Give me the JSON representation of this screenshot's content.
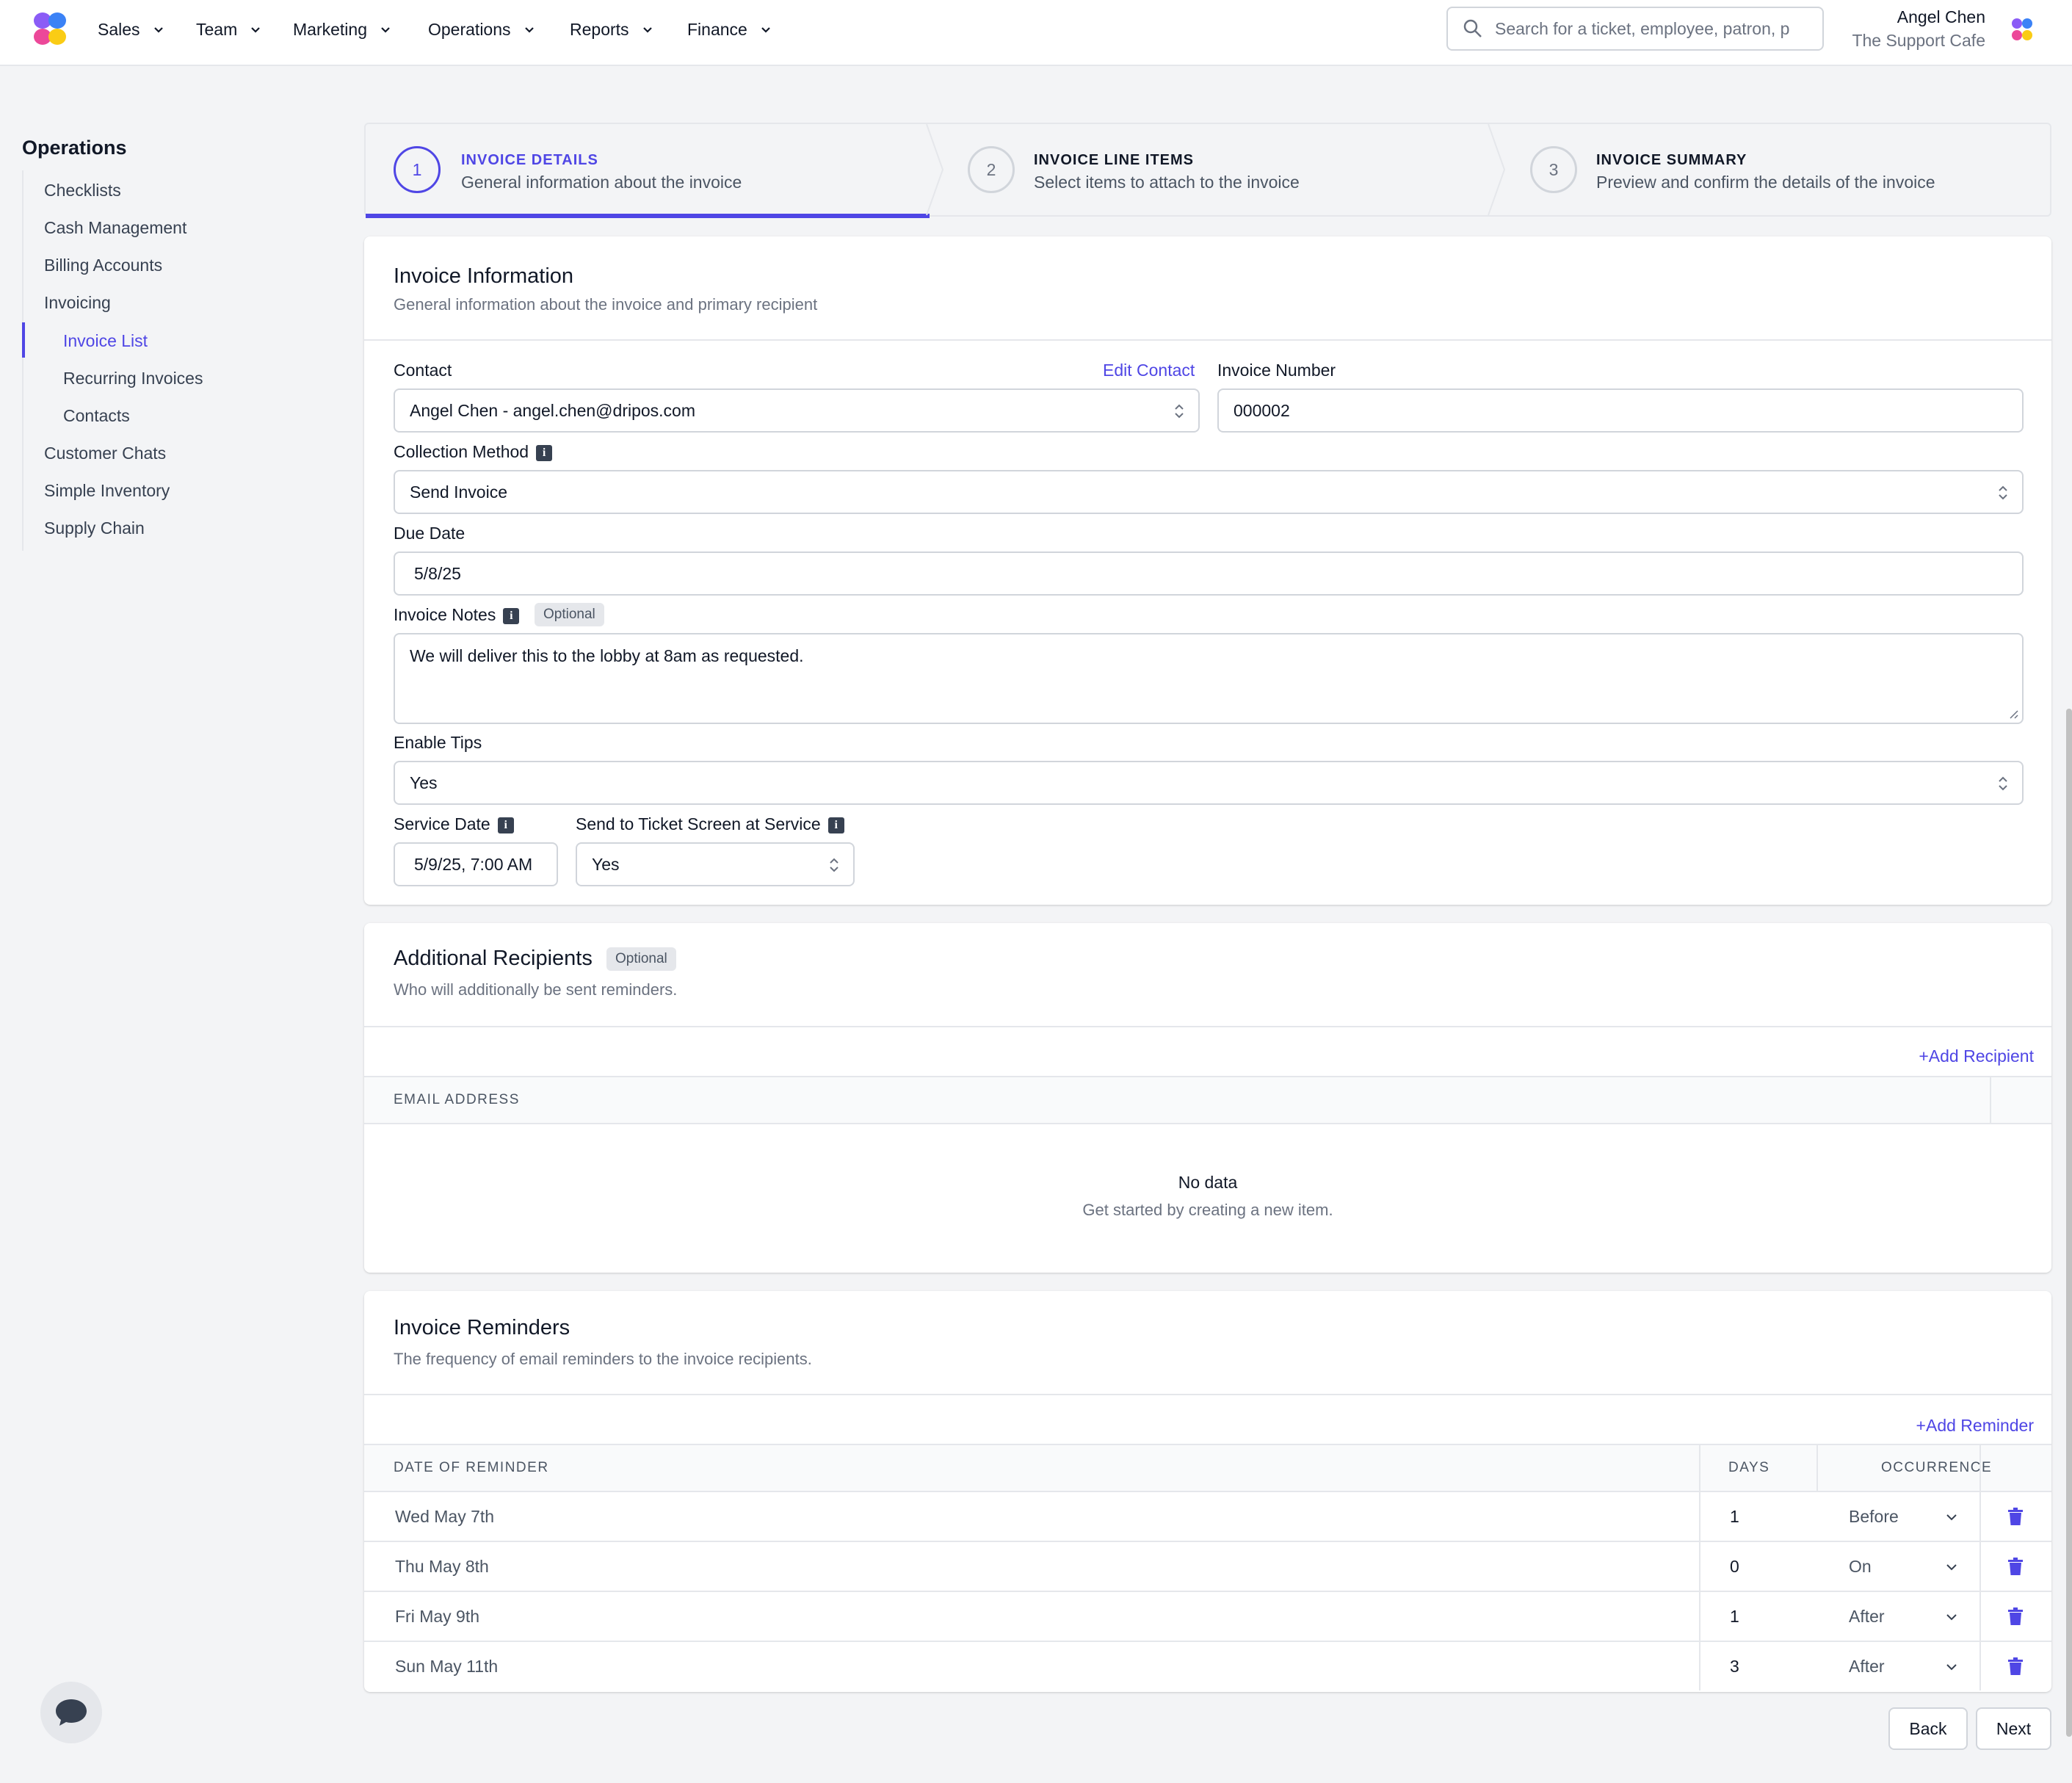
{
  "nav": {
    "items": [
      "Sales",
      "Team",
      "Marketing",
      "Operations",
      "Reports",
      "Finance"
    ],
    "search_placeholder": "Search for a ticket, employee, patron, p",
    "user_name": "Angel Chen",
    "user_org": "The Support Cafe"
  },
  "sidebar": {
    "title": "Operations",
    "items": [
      "Checklists",
      "Cash Management",
      "Billing Accounts",
      "Invoicing",
      "Invoice List",
      "Recurring Invoices",
      "Contacts",
      "Customer Chats",
      "Simple Inventory",
      "Supply Chain"
    ],
    "active": "Invoice List"
  },
  "stepper": {
    "steps": [
      {
        "number": "1",
        "title": "INVOICE DETAILS",
        "desc": "General information about the invoice"
      },
      {
        "number": "2",
        "title": "INVOICE LINE ITEMS",
        "desc": "Select items to attach to the invoice"
      },
      {
        "number": "3",
        "title": "INVOICE SUMMARY",
        "desc": "Preview and confirm the details of the invoice"
      }
    ]
  },
  "invoice_info": {
    "title": "Invoice Information",
    "subtitle": "General information about the invoice and primary recipient",
    "contact_label": "Contact",
    "edit_contact": "Edit Contact",
    "contact_value": "Angel Chen - angel.chen@dripos.com",
    "invoice_number_label": "Invoice Number",
    "invoice_number_value": "000002",
    "collection_method_label": "Collection Method",
    "collection_method_value": "Send Invoice",
    "due_date_label": "Due Date",
    "due_date_value": "5/8/25",
    "notes_label": "Invoice Notes",
    "optional": "Optional",
    "notes_value": "We will deliver this to the lobby at 8am as requested.",
    "tips_label": "Enable Tips",
    "tips_value": "Yes",
    "service_date_label": "Service Date",
    "service_date_value": "5/9/25, 7:00 AM",
    "ticket_screen_label": "Send to Ticket Screen at Service",
    "ticket_screen_value": "Yes"
  },
  "recipients": {
    "title": "Additional Recipients",
    "optional": "Optional",
    "subtitle": "Who will additionally be sent reminders.",
    "add": "+Add Recipient",
    "col_email": "EMAIL ADDRESS",
    "empty_title": "No data",
    "empty_sub": "Get started by creating a new item."
  },
  "reminders": {
    "title": "Invoice Reminders",
    "subtitle": "The frequency of email reminders to the invoice recipients.",
    "add": "+Add Reminder",
    "columns": [
      "DATE OF REMINDER",
      "DAYS",
      "OCCURRENCE"
    ],
    "rows": [
      {
        "date": "Wed May 7th",
        "days": "1",
        "occurrence": "Before"
      },
      {
        "date": "Thu May 8th",
        "days": "0",
        "occurrence": "On"
      },
      {
        "date": "Fri May 9th",
        "days": "1",
        "occurrence": "After"
      },
      {
        "date": "Sun May 11th",
        "days": "3",
        "occurrence": "After"
      }
    ]
  },
  "footer": {
    "back": "Back",
    "next": "Next"
  },
  "colors": {
    "accent": "#4f46e5",
    "background": "#f3f4f6",
    "border": "#d1d5db"
  },
  "icons": [
    "app-logo-icon",
    "chevron-down-icon",
    "search-icon",
    "info-icon",
    "updown-icon",
    "trash-icon",
    "chat-bubble-icon"
  ]
}
